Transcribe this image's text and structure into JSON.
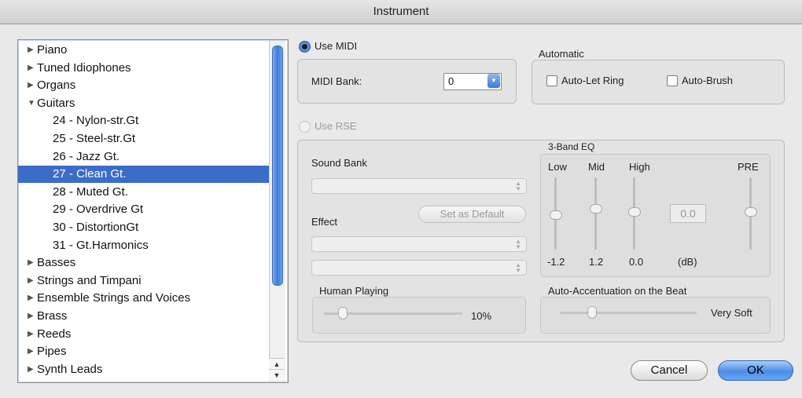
{
  "window": {
    "title": "Instrument"
  },
  "tree": {
    "items": [
      {
        "label": "Piano",
        "expander": "▶",
        "level": 0,
        "selected": false
      },
      {
        "label": "Tuned Idiophones",
        "expander": "▶",
        "level": 0,
        "selected": false
      },
      {
        "label": "Organs",
        "expander": "▶",
        "level": 0,
        "selected": false
      },
      {
        "label": "Guitars",
        "expander": "▼",
        "level": 0,
        "selected": false
      },
      {
        "label": "24 - Nylon-str.Gt",
        "expander": "",
        "level": 1,
        "selected": false
      },
      {
        "label": "25 - Steel-str.Gt",
        "expander": "",
        "level": 1,
        "selected": false
      },
      {
        "label": "26 - Jazz Gt.",
        "expander": "",
        "level": 1,
        "selected": false
      },
      {
        "label": "27 - Clean Gt.",
        "expander": "",
        "level": 1,
        "selected": true
      },
      {
        "label": "28 - Muted Gt.",
        "expander": "",
        "level": 1,
        "selected": false
      },
      {
        "label": "29 - Overdrive Gt",
        "expander": "",
        "level": 1,
        "selected": false
      },
      {
        "label": "30 - DistortionGt",
        "expander": "",
        "level": 1,
        "selected": false
      },
      {
        "label": "31 - Gt.Harmonics",
        "expander": "",
        "level": 1,
        "selected": false
      },
      {
        "label": "Basses",
        "expander": "▶",
        "level": 0,
        "selected": false
      },
      {
        "label": "Strings and Timpani",
        "expander": "▶",
        "level": 0,
        "selected": false
      },
      {
        "label": "Ensemble Strings and Voices",
        "expander": "▶",
        "level": 0,
        "selected": false
      },
      {
        "label": "Brass",
        "expander": "▶",
        "level": 0,
        "selected": false
      },
      {
        "label": "Reeds",
        "expander": "▶",
        "level": 0,
        "selected": false
      },
      {
        "label": "Pipes",
        "expander": "▶",
        "level": 0,
        "selected": false
      },
      {
        "label": "Synth Leads",
        "expander": "▶",
        "level": 0,
        "selected": false
      }
    ]
  },
  "midi": {
    "use_midi_label": "Use MIDI",
    "bank_label": "MIDI Bank:",
    "bank_value": "0",
    "automatic_label": "Automatic",
    "auto_let_ring_label": "Auto-Let Ring",
    "auto_brush_label": "Auto-Brush"
  },
  "rse": {
    "use_rse_label": "Use RSE",
    "sound_bank_label": "Sound Bank",
    "effect_label": "Effect",
    "set_default_label": "Set as Default",
    "eq": {
      "title": "3-Band EQ",
      "bands": [
        {
          "label": "Low",
          "value": "-1.2",
          "level": 0.45
        },
        {
          "label": "Mid",
          "value": "1.2",
          "level": 0.55
        },
        {
          "label": "High",
          "value": "0.0",
          "level": 0.5
        }
      ],
      "gain_display": "0.0",
      "unit": "(dB)",
      "pre_label": "PRE",
      "pre_level": 0.5
    },
    "human_playing": {
      "label": "Human Playing",
      "value_text": "10%",
      "value": 0.1
    },
    "accentuation": {
      "label": "Auto-Accentuation on the Beat",
      "value_text": "Very Soft",
      "value": 0.2
    }
  },
  "buttons": {
    "cancel": "Cancel",
    "ok": "OK"
  }
}
